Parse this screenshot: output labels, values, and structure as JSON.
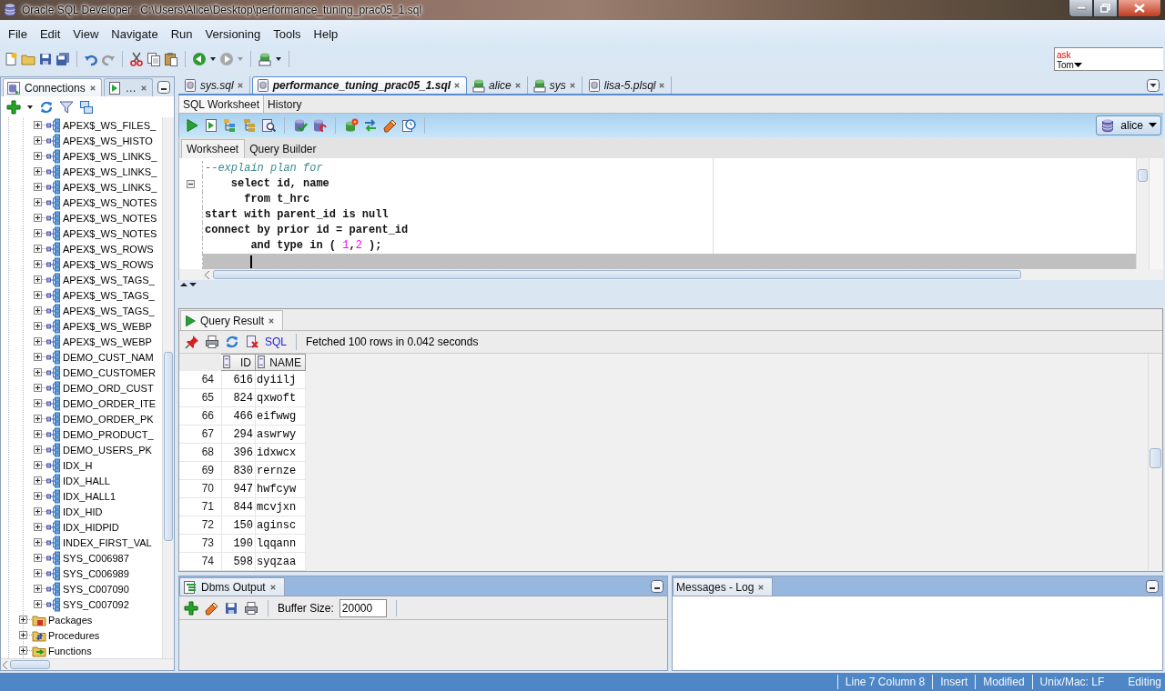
{
  "window": {
    "title": "Oracle SQL Developer : C:\\Users\\Alice\\Desktop\\performance_tuning_prac05_1.sql"
  },
  "menu": [
    "File",
    "Edit",
    "View",
    "Navigate",
    "Run",
    "Versioning",
    "Tools",
    "Help"
  ],
  "ask_tom": {
    "ask": "ask",
    "tom": "Tom"
  },
  "navigator": {
    "tabs": [
      {
        "label": "Connections",
        "selected": true
      },
      {
        "label": "…",
        "selected": false
      }
    ],
    "index_nodes": [
      {
        "label": "APEX$_WS_FILES_",
        "expanded": false
      },
      {
        "label": "APEX$_WS_HISTO",
        "expanded": false
      },
      {
        "label": "APEX$_WS_LINKS_",
        "expanded": false
      },
      {
        "label": "APEX$_WS_LINKS_",
        "expanded": false
      },
      {
        "label": "APEX$_WS_LINKS_",
        "expanded": false
      },
      {
        "label": "APEX$_WS_NOTES",
        "expanded": false
      },
      {
        "label": "APEX$_WS_NOTES",
        "expanded": false
      },
      {
        "label": "APEX$_WS_NOTES",
        "expanded": false
      },
      {
        "label": "APEX$_WS_ROWS",
        "expanded": false
      },
      {
        "label": "APEX$_WS_ROWS",
        "expanded": false
      },
      {
        "label": "APEX$_WS_TAGS_",
        "expanded": false
      },
      {
        "label": "APEX$_WS_TAGS_",
        "expanded": false
      },
      {
        "label": "APEX$_WS_TAGS_",
        "expanded": false
      },
      {
        "label": "APEX$_WS_WEBP",
        "expanded": false
      },
      {
        "label": "APEX$_WS_WEBP",
        "expanded": false
      },
      {
        "label": "DEMO_CUST_NAM",
        "expanded": false
      },
      {
        "label": "DEMO_CUSTOMER",
        "expanded": false
      },
      {
        "label": "DEMO_ORD_CUST",
        "expanded": false
      },
      {
        "label": "DEMO_ORDER_ITE",
        "expanded": false
      },
      {
        "label": "DEMO_ORDER_PK",
        "expanded": false
      },
      {
        "label": "DEMO_PRODUCT_",
        "expanded": false
      },
      {
        "label": "DEMO_USERS_PK",
        "expanded": false
      },
      {
        "label": "IDX_H",
        "expanded": false
      },
      {
        "label": "IDX_HALL",
        "expanded": false
      },
      {
        "label": "IDX_HALL1",
        "expanded": false
      },
      {
        "label": "IDX_HID",
        "expanded": false
      },
      {
        "label": "IDX_HIDPID",
        "expanded": false
      },
      {
        "label": "INDEX_FIRST_VAL",
        "expanded": false
      },
      {
        "label": "SYS_C006987",
        "expanded": false
      },
      {
        "label": "SYS_C006989",
        "expanded": false
      },
      {
        "label": "SYS_C007090",
        "expanded": false
      },
      {
        "label": "SYS_C007092",
        "expanded": false
      }
    ],
    "folders": [
      {
        "label": "Packages",
        "kind": "packages",
        "expanded": false
      },
      {
        "label": "Procedures",
        "kind": "procedures",
        "expanded": false
      },
      {
        "label": "Functions",
        "kind": "functions",
        "expanded": false
      }
    ]
  },
  "editor_tabs": [
    {
      "label": "sys.sql",
      "kind": "file",
      "selected": false
    },
    {
      "label": "performance_tuning_prac05_1.sql",
      "kind": "file",
      "selected": true
    },
    {
      "label": "alice",
      "kind": "connection",
      "selected": false
    },
    {
      "label": "sys",
      "kind": "connection",
      "selected": false
    },
    {
      "label": "lisa-5.plsql",
      "kind": "file",
      "selected": false
    }
  ],
  "sub_tabs": [
    {
      "label": "SQL Worksheet",
      "selected": true
    },
    {
      "label": "History",
      "selected": false
    }
  ],
  "connection": "alice",
  "worksheet_tabs": [
    {
      "label": "Worksheet",
      "selected": true
    },
    {
      "label": "Query Builder",
      "selected": false
    }
  ],
  "code_lines": [
    {
      "foldable": false,
      "current": false,
      "tokens": [
        {
          "text": "--explain plan for",
          "kind": "comment"
        }
      ]
    },
    {
      "foldable": true,
      "current": false,
      "tokens": [
        {
          "text": "    select id, name",
          "kind": "code"
        }
      ]
    },
    {
      "foldable": false,
      "current": false,
      "tokens": [
        {
          "text": "      from t_hrc",
          "kind": "code"
        }
      ]
    },
    {
      "foldable": false,
      "current": false,
      "tokens": [
        {
          "text": "start with parent_id is null",
          "kind": "code"
        }
      ]
    },
    {
      "foldable": false,
      "current": false,
      "tokens": [
        {
          "text": "connect by prior id = parent_id",
          "kind": "code"
        }
      ]
    },
    {
      "foldable": false,
      "current": false,
      "tokens": [
        {
          "text": "       and type in ( ",
          "kind": "code"
        },
        {
          "text": "1",
          "kind": "number"
        },
        {
          "text": ",",
          "kind": "code"
        },
        {
          "text": "2",
          "kind": "number"
        },
        {
          "text": " );",
          "kind": "code"
        }
      ]
    },
    {
      "foldable": false,
      "current": true
    }
  ],
  "query_result": {
    "tab": "Query Result",
    "link": "SQL",
    "message": "Fetched 100 rows in 0.042 seconds",
    "columns": [
      "ID",
      "NAME"
    ],
    "rows": [
      {
        "num": "64",
        "id": "616",
        "name": "dyiilj"
      },
      {
        "num": "65",
        "id": "824",
        "name": "qxwoft"
      },
      {
        "num": "66",
        "id": "466",
        "name": "eifwwg"
      },
      {
        "num": "67",
        "id": "294",
        "name": "aswrwy"
      },
      {
        "num": "68",
        "id": "396",
        "name": "idxwcx"
      },
      {
        "num": "69",
        "id": "830",
        "name": "rernze"
      },
      {
        "num": "70",
        "id": "947",
        "name": "hwfcyw"
      },
      {
        "num": "71",
        "id": "844",
        "name": "mcvjxn"
      },
      {
        "num": "72",
        "id": "150",
        "name": "aginsc"
      },
      {
        "num": "73",
        "id": "190",
        "name": "lqqann"
      },
      {
        "num": "74",
        "id": "598",
        "name": "syqzaa"
      }
    ]
  },
  "dbms_output": {
    "tab": "Dbms Output",
    "buffer_label": "Buffer Size:",
    "buffer_value": "20000"
  },
  "log": {
    "tab": "Messages - Log"
  },
  "status_bar": [
    "Line 7 Column 8",
    "Insert",
    "Modified",
    "Unix/Mac: LF",
    "Editing"
  ]
}
